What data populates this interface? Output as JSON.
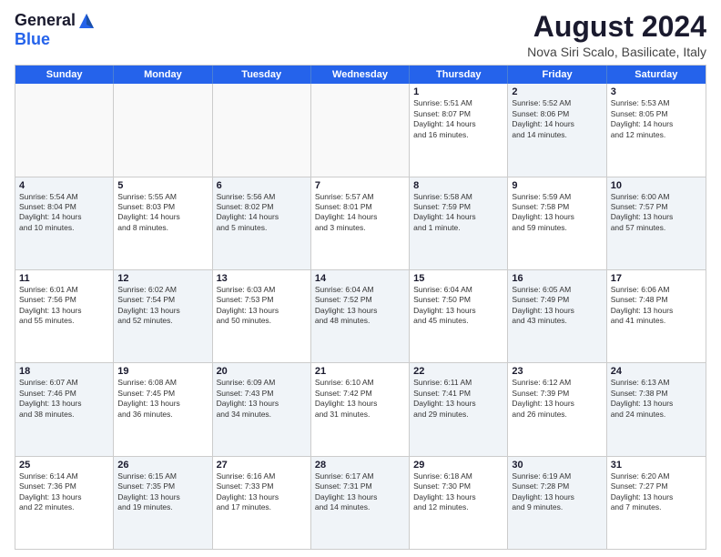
{
  "logo": {
    "general": "General",
    "blue": "Blue"
  },
  "title": "August 2024",
  "location": "Nova Siri Scalo, Basilicate, Italy",
  "header_days": [
    "Sunday",
    "Monday",
    "Tuesday",
    "Wednesday",
    "Thursday",
    "Friday",
    "Saturday"
  ],
  "rows": [
    [
      {
        "day": "",
        "info": ""
      },
      {
        "day": "",
        "info": ""
      },
      {
        "day": "",
        "info": ""
      },
      {
        "day": "",
        "info": ""
      },
      {
        "day": "1",
        "info": "Sunrise: 5:51 AM\nSunset: 8:07 PM\nDaylight: 14 hours\nand 16 minutes."
      },
      {
        "day": "2",
        "info": "Sunrise: 5:52 AM\nSunset: 8:06 PM\nDaylight: 14 hours\nand 14 minutes."
      },
      {
        "day": "3",
        "info": "Sunrise: 5:53 AM\nSunset: 8:05 PM\nDaylight: 14 hours\nand 12 minutes."
      }
    ],
    [
      {
        "day": "4",
        "info": "Sunrise: 5:54 AM\nSunset: 8:04 PM\nDaylight: 14 hours\nand 10 minutes."
      },
      {
        "day": "5",
        "info": "Sunrise: 5:55 AM\nSunset: 8:03 PM\nDaylight: 14 hours\nand 8 minutes."
      },
      {
        "day": "6",
        "info": "Sunrise: 5:56 AM\nSunset: 8:02 PM\nDaylight: 14 hours\nand 5 minutes."
      },
      {
        "day": "7",
        "info": "Sunrise: 5:57 AM\nSunset: 8:01 PM\nDaylight: 14 hours\nand 3 minutes."
      },
      {
        "day": "8",
        "info": "Sunrise: 5:58 AM\nSunset: 7:59 PM\nDaylight: 14 hours\nand 1 minute."
      },
      {
        "day": "9",
        "info": "Sunrise: 5:59 AM\nSunset: 7:58 PM\nDaylight: 13 hours\nand 59 minutes."
      },
      {
        "day": "10",
        "info": "Sunrise: 6:00 AM\nSunset: 7:57 PM\nDaylight: 13 hours\nand 57 minutes."
      }
    ],
    [
      {
        "day": "11",
        "info": "Sunrise: 6:01 AM\nSunset: 7:56 PM\nDaylight: 13 hours\nand 55 minutes."
      },
      {
        "day": "12",
        "info": "Sunrise: 6:02 AM\nSunset: 7:54 PM\nDaylight: 13 hours\nand 52 minutes."
      },
      {
        "day": "13",
        "info": "Sunrise: 6:03 AM\nSunset: 7:53 PM\nDaylight: 13 hours\nand 50 minutes."
      },
      {
        "day": "14",
        "info": "Sunrise: 6:04 AM\nSunset: 7:52 PM\nDaylight: 13 hours\nand 48 minutes."
      },
      {
        "day": "15",
        "info": "Sunrise: 6:04 AM\nSunset: 7:50 PM\nDaylight: 13 hours\nand 45 minutes."
      },
      {
        "day": "16",
        "info": "Sunrise: 6:05 AM\nSunset: 7:49 PM\nDaylight: 13 hours\nand 43 minutes."
      },
      {
        "day": "17",
        "info": "Sunrise: 6:06 AM\nSunset: 7:48 PM\nDaylight: 13 hours\nand 41 minutes."
      }
    ],
    [
      {
        "day": "18",
        "info": "Sunrise: 6:07 AM\nSunset: 7:46 PM\nDaylight: 13 hours\nand 38 minutes."
      },
      {
        "day": "19",
        "info": "Sunrise: 6:08 AM\nSunset: 7:45 PM\nDaylight: 13 hours\nand 36 minutes."
      },
      {
        "day": "20",
        "info": "Sunrise: 6:09 AM\nSunset: 7:43 PM\nDaylight: 13 hours\nand 34 minutes."
      },
      {
        "day": "21",
        "info": "Sunrise: 6:10 AM\nSunset: 7:42 PM\nDaylight: 13 hours\nand 31 minutes."
      },
      {
        "day": "22",
        "info": "Sunrise: 6:11 AM\nSunset: 7:41 PM\nDaylight: 13 hours\nand 29 minutes."
      },
      {
        "day": "23",
        "info": "Sunrise: 6:12 AM\nSunset: 7:39 PM\nDaylight: 13 hours\nand 26 minutes."
      },
      {
        "day": "24",
        "info": "Sunrise: 6:13 AM\nSunset: 7:38 PM\nDaylight: 13 hours\nand 24 minutes."
      }
    ],
    [
      {
        "day": "25",
        "info": "Sunrise: 6:14 AM\nSunset: 7:36 PM\nDaylight: 13 hours\nand 22 minutes."
      },
      {
        "day": "26",
        "info": "Sunrise: 6:15 AM\nSunset: 7:35 PM\nDaylight: 13 hours\nand 19 minutes."
      },
      {
        "day": "27",
        "info": "Sunrise: 6:16 AM\nSunset: 7:33 PM\nDaylight: 13 hours\nand 17 minutes."
      },
      {
        "day": "28",
        "info": "Sunrise: 6:17 AM\nSunset: 7:31 PM\nDaylight: 13 hours\nand 14 minutes."
      },
      {
        "day": "29",
        "info": "Sunrise: 6:18 AM\nSunset: 7:30 PM\nDaylight: 13 hours\nand 12 minutes."
      },
      {
        "day": "30",
        "info": "Sunrise: 6:19 AM\nSunset: 7:28 PM\nDaylight: 13 hours\nand 9 minutes."
      },
      {
        "day": "31",
        "info": "Sunrise: 6:20 AM\nSunset: 7:27 PM\nDaylight: 13 hours\nand 7 minutes."
      }
    ]
  ]
}
